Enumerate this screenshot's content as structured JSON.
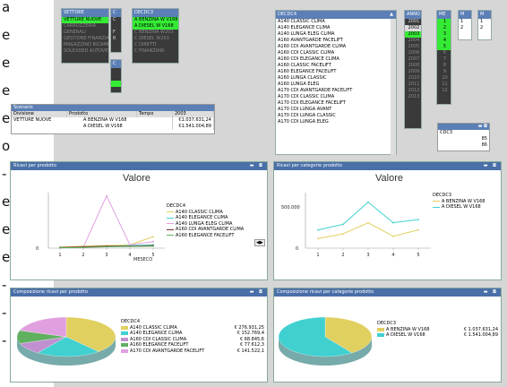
{
  "sidebar": {
    "lines": [
      "a",
      "e",
      "e",
      "e",
      "e",
      "o",
      "-",
      "e",
      "e",
      "e",
      "-",
      "-",
      "-"
    ]
  },
  "listbox_settore": {
    "title": "SETTORE",
    "items": [
      "VETTURE NUOVE",
      "CARROZZERIA",
      "GENERALI",
      "GESTIONE FINANZIARIA",
      "MAGAZZINO RICAMBI",
      "SOLEXDED AUTOVETTURE"
    ]
  },
  "listbox_small1": {
    "title": "C",
    "items": [
      "C",
      "",
      "F",
      "R",
      ""
    ]
  },
  "listbox_small2": {
    "title": "C",
    "items": [
      "",
      "",
      ""
    ]
  },
  "listbox_decdc3": {
    "title": "DECDC3",
    "items": [
      "A BENZINA W V168",
      "A DIESEL W V168",
      "C BENZINA W203",
      "C DIESEL W203",
      "C DIRETTI",
      "C FINANZIARI"
    ]
  },
  "listbox_decdc4": {
    "title": "DECDC4",
    "items": [
      "A140 CLASSIC CLIMA",
      "A140 ELEGANCE CLIMA",
      "A140 LUNGA ELEG CLIMA",
      "A160 AVANTGARDE FACELIFT",
      "A160 CDI AVANTGARDE CLIMA",
      "A160 CDI CLASSIC CLIMA",
      "A160 CDI ELEGANCE CLIMA",
      "A160 CLASSIC FACELIFT",
      "A160 ELEGANCE FACELIFT",
      "A160 LUNGA CLASSIC",
      "A160 LUNGA ELEG",
      "A170 CDI AVANTGARDE FACELIFT",
      "A170 CDI CLASSIC CLIMA",
      "A170 CDI ELEGANCE FACELIFT",
      "A170 CDI LUNGA AVANT",
      "A170 CDI LUNGA CLASSIC",
      "A170 CDI LUNGA ELEG"
    ]
  },
  "listbox_anno": {
    "title": "ANNO",
    "items": [
      "2001",
      "2002",
      "2003",
      "2004",
      "2005",
      "2006",
      "2007",
      "2008",
      "2009",
      "2010",
      "2011",
      "2012",
      "2013"
    ]
  },
  "listbox_mese": {
    "title": "ME",
    "items": [
      "1",
      "2",
      "3",
      "4",
      "5",
      "6",
      "7",
      "8",
      "9",
      "10",
      "11",
      "12"
    ]
  },
  "listbox_m1": {
    "title": "M",
    "items": [
      "1",
      "2"
    ]
  },
  "listbox_m2": {
    "title": "M",
    "items": [
      "1",
      "2"
    ]
  },
  "mini_box": {
    "title": "",
    "col": "CDC3",
    "rows": [
      "85",
      "86"
    ]
  },
  "table_scenario": {
    "title": "Scenario",
    "headers": [
      "Divisione",
      "Prodotto",
      "Tempo",
      "2003"
    ],
    "rows": [
      {
        "div": "VETTURE NUOVE",
        "prod": "A BENZINA W V168",
        "val": "€1.037.631,24"
      },
      {
        "div": "",
        "prod": "A DIESEL W V168",
        "val": "€1.541.004,89"
      }
    ]
  },
  "panel1": {
    "header": "Ricavi per prodotto",
    "title": "Valore",
    "legend_title": "DECDC4",
    "legend": [
      "A140 CLASSIC CLIMA",
      "A140 ELEGANCE CLIMA",
      "A140 LUNGA ELEG CLIMA",
      "A160 CDI AVANTGARDE CLIMA",
      "A160 ELEGANCE FACELIFT"
    ],
    "xlabel": "MESECO",
    "y0": "0"
  },
  "panel2": {
    "header": "Ricavi per categorie prodotto",
    "title": "Valore",
    "legend_title": "DECDC3",
    "legend": [
      "A BENZINA W V168",
      "A DIESEL W V168"
    ],
    "y_top": "500.000",
    "y0": "0"
  },
  "panel3": {
    "header": "Composizione ricavi per prodotto",
    "legend_title": "DECDC4",
    "legend": [
      {
        "name": "A140 CLASSIC CLIMA",
        "val": "€ 276.931,25"
      },
      {
        "name": "A140 ELEGANCE CLIMA",
        "val": "€ 152.769,4"
      },
      {
        "name": "A160 CDI CLASSIC CLIMA",
        "val": "€ 68.845,6"
      },
      {
        "name": "A160 ELEGANCE FACELIFT",
        "val": "€ 77.612,3"
      },
      {
        "name": "A170 CDI AVANTGARDE FACELIFT",
        "val": "€ 141.522,1"
      }
    ]
  },
  "panel4": {
    "header": "Composizione ricavi per categorie prodotto",
    "legend_title": "DECDC3",
    "legend": [
      {
        "name": "A BENZINA W V168",
        "val": "€ 1.037.631,24"
      },
      {
        "name": "A DIESEL W V168",
        "val": "€ 1.541.004,89"
      }
    ]
  },
  "colors": {
    "yellow": "#e0d060",
    "cyan": "#40d0d0",
    "pink": "#e0a0e0",
    "darkred": "#7a3030",
    "green": "#60b060",
    "purple": "#c090d0",
    "select_green": "#35ea35",
    "header_blue": "#4a6fa8"
  },
  "chart_data": [
    {
      "type": "line",
      "x": [
        1,
        2,
        3,
        4,
        5
      ],
      "series": [
        {
          "name": "A140 CLASSIC CLIMA",
          "values": [
            3,
            6,
            8,
            10,
            35
          ]
        },
        {
          "name": "A140 ELEGANCE CLIMA",
          "values": [
            2,
            3,
            5,
            8,
            10
          ]
        },
        {
          "name": "A140 LUNGA ELEG CLIMA",
          "values": [
            1,
            3,
            160,
            10,
            20
          ]
        },
        {
          "name": "A160 CDI AVANTGARDE CLIMA",
          "values": [
            2,
            4,
            6,
            6,
            8
          ]
        },
        {
          "name": "A160 ELEGANCE FACELIFT",
          "values": [
            1,
            2,
            4,
            5,
            6
          ]
        }
      ],
      "title": "Valore",
      "xlabel": "MESECO"
    },
    {
      "type": "line",
      "x": [
        1,
        2,
        3,
        4,
        5
      ],
      "series": [
        {
          "name": "A BENZINA W V168",
          "values": [
            120000,
            180000,
            320000,
            150000,
            230000
          ]
        },
        {
          "name": "A DIESEL W V168",
          "values": [
            230000,
            300000,
            580000,
            320000,
            360000
          ]
        }
      ],
      "title": "Valore",
      "ylim": [
        0,
        700000
      ]
    },
    {
      "type": "pie",
      "categories": [
        "A140 CLASSIC CLIMA",
        "A140 ELEGANCE CLIMA",
        "A160 CDI CLASSIC CLIMA",
        "A160 ELEGANCE FACELIFT",
        "A170 CDI AVANTGARDE FACELIFT"
      ],
      "values": [
        276931.25,
        152769.4,
        68845.6,
        77612.3,
        141522.1
      ]
    },
    {
      "type": "pie",
      "categories": [
        "A BENZINA W V168",
        "A DIESEL W V168"
      ],
      "values": [
        1037631.24,
        1541004.89
      ]
    }
  ]
}
